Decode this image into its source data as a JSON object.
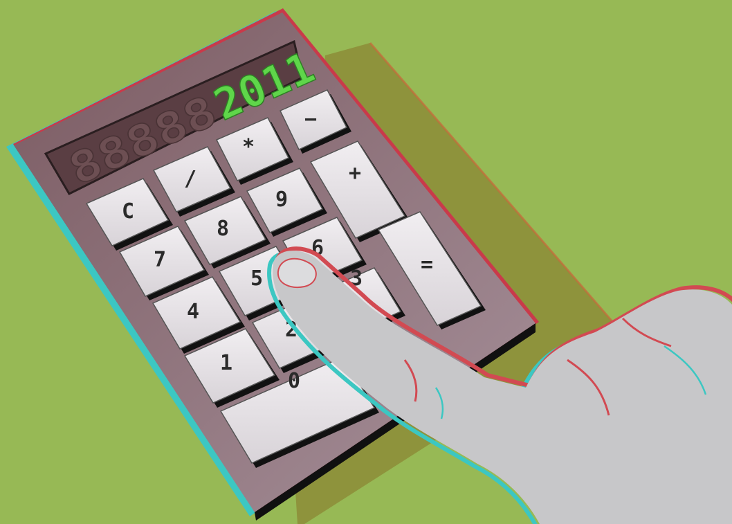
{
  "display": {
    "dim_digits": "88888",
    "lit_digits": "2011"
  },
  "keys": {
    "c": "C",
    "divide": "/",
    "multiply": "*",
    "minus": "−",
    "plus": "+",
    "seven": "7",
    "eight": "8",
    "nine": "9",
    "four": "4",
    "five": "5",
    "six": "6",
    "one": "1",
    "two": "2",
    "three": "3",
    "zero": "0",
    "equals": "="
  },
  "colors": {
    "background": "#97b955",
    "calculator_body": "#8a6a70",
    "key_face": "#e6e2e6",
    "display_lit": "#5fd64a",
    "hand": "#c7c7c9"
  }
}
